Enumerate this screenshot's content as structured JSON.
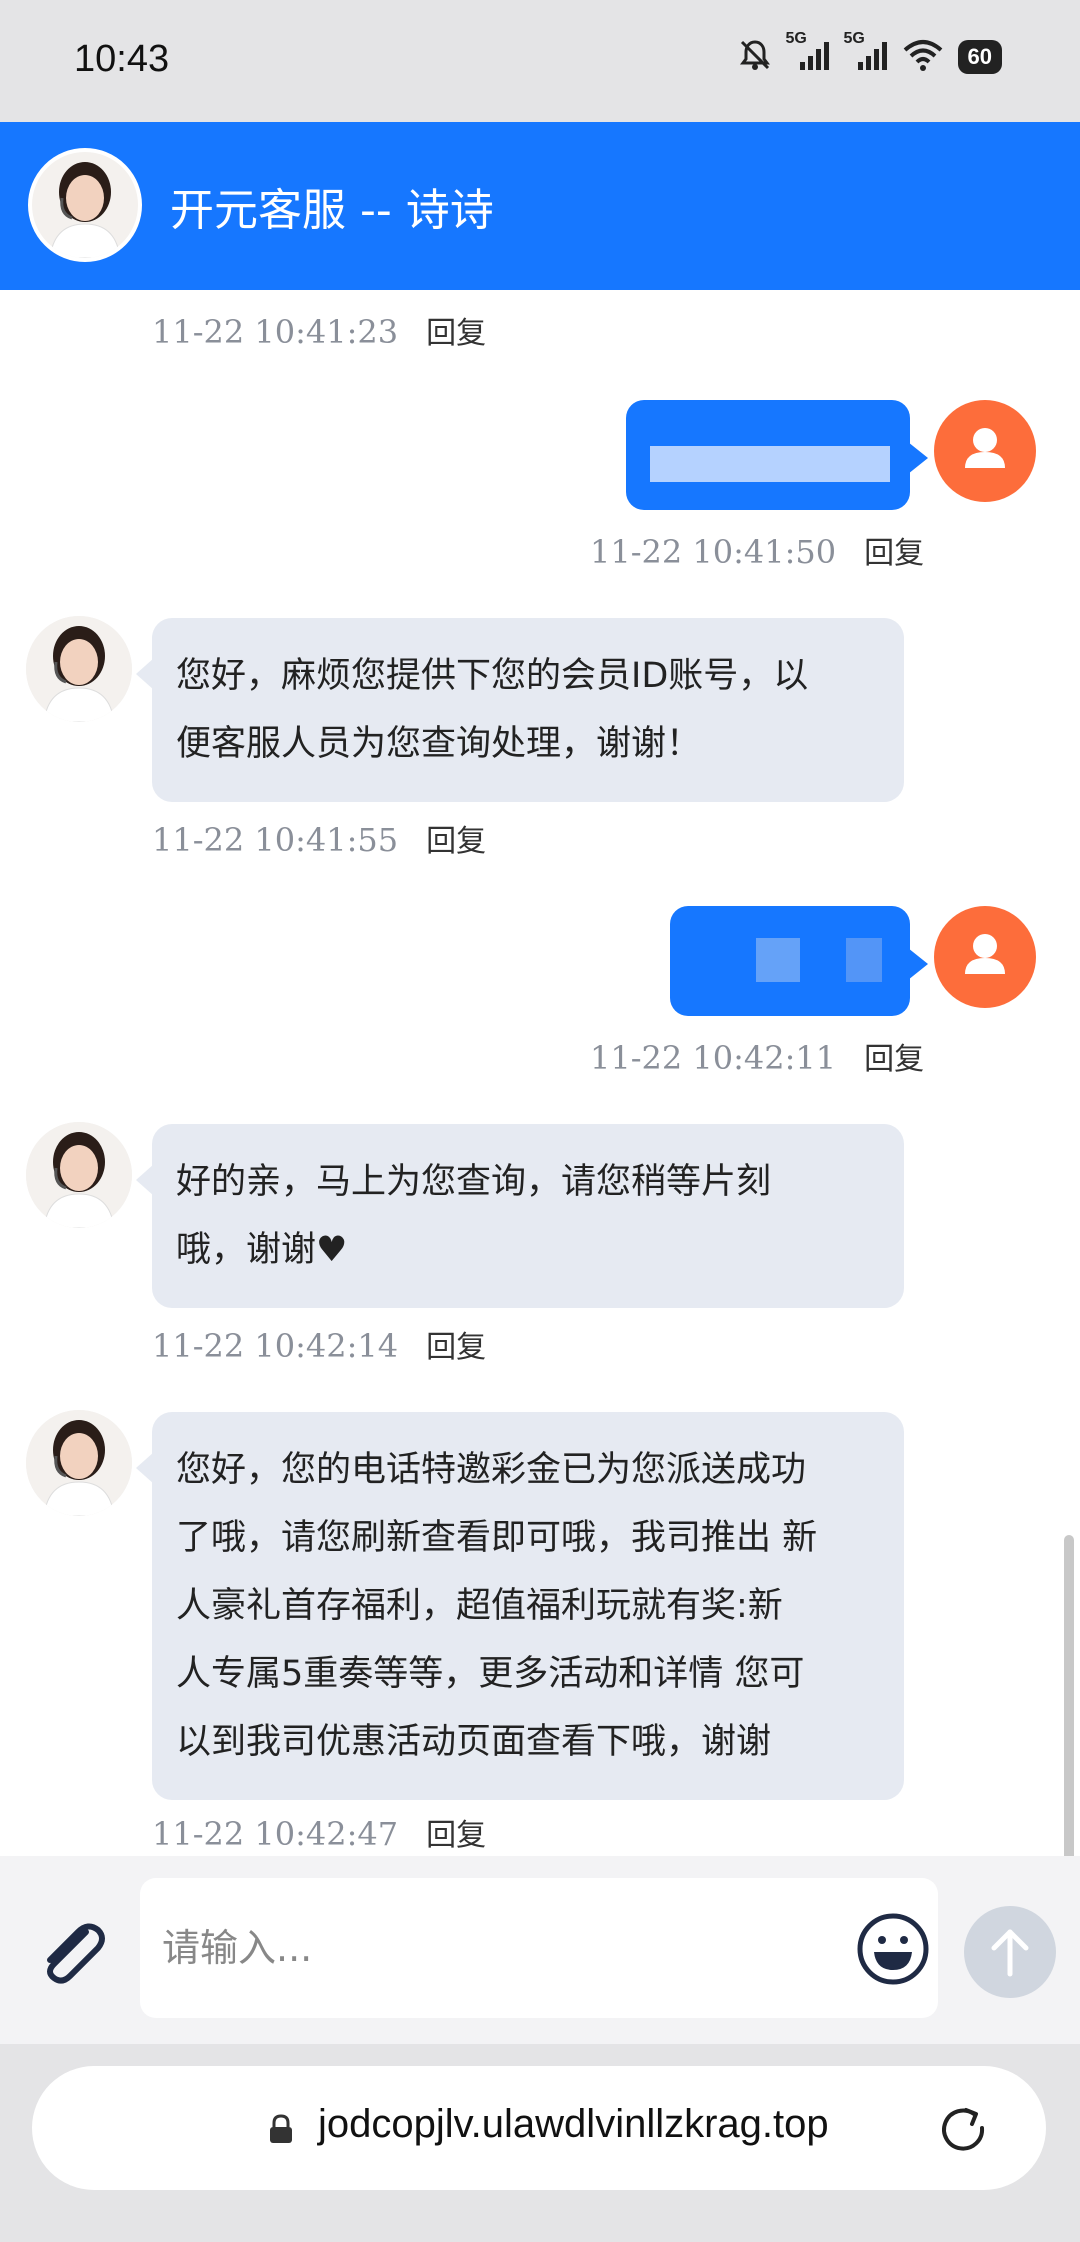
{
  "status_bar": {
    "time": "10:43",
    "signal1_label": "5G",
    "signal2_label": "5G",
    "battery": "60"
  },
  "header": {
    "title": "开元客服 -- 诗诗"
  },
  "messages": [
    {
      "type": "meta",
      "time": "11-22 10:41:23",
      "reply": "回复"
    },
    {
      "type": "outgoing",
      "content": "[blurred]",
      "time": "11-22 10:41:50",
      "reply": "回复"
    },
    {
      "type": "incoming",
      "lines": [
        "您好，麻烦您提供下您的会员ID账号，以",
        "便客服人员为您查询处理，谢谢！"
      ],
      "time": "11-22 10:41:55",
      "reply": "回复"
    },
    {
      "type": "outgoing",
      "content": "[blurred]",
      "time": "11-22 10:42:11",
      "reply": "回复"
    },
    {
      "type": "incoming",
      "lines": [
        "好的亲，马上为您查询，请您稍等片刻",
        "哦，谢谢♥"
      ],
      "time": "11-22 10:42:14",
      "reply": "回复"
    },
    {
      "type": "incoming",
      "lines": [
        "您好，您的电话特邀彩金已为您派送成功",
        "了哦，请您刷新查看即可哦，我司推出 新",
        "人豪礼首存福利，超值福利玩就有奖:新",
        "人专属5重奏等等，更多活动和详情 您可",
        "以到我司优惠活动页面查看下哦，谢谢"
      ],
      "time": "11-22 10:42:47",
      "reply": "回复"
    }
  ],
  "input": {
    "placeholder": "请输入..."
  },
  "browser": {
    "url": "jodcopjlv.ulawdlvinllzkrag.top"
  },
  "colors": {
    "brand": "#1677ff",
    "user_avatar": "#fd6d3b",
    "bubble_in": "#e6eaf2"
  },
  "icons": [
    "attach-icon",
    "emoji-icon",
    "send-arrow-icon",
    "lock-icon",
    "refresh-icon",
    "user-icon",
    "bell-off-icon",
    "wifi-icon"
  ]
}
